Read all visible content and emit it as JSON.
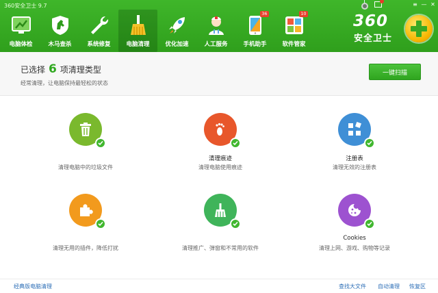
{
  "app": {
    "title": "360安全卫士 9.7"
  },
  "nav": [
    {
      "label": "电脑体检",
      "icon": "pc-check-icon"
    },
    {
      "label": "木马查杀",
      "icon": "horse-shield-icon"
    },
    {
      "label": "系统修复",
      "icon": "wrench-icon"
    },
    {
      "label": "电脑清理",
      "icon": "broom-icon",
      "active": true
    },
    {
      "label": "优化加速",
      "icon": "rocket-icon"
    },
    {
      "label": "人工服务",
      "icon": "doctor-icon"
    },
    {
      "label": "手机助手",
      "icon": "phone-icon",
      "badge": "36"
    },
    {
      "label": "软件管家",
      "icon": "software-box-icon",
      "badge": "10"
    }
  ],
  "brand": {
    "number": "360",
    "name": "安全卫士"
  },
  "header": {
    "prefix": "已选择",
    "count": "6",
    "suffix": "项清理类型",
    "subtitle": "经常清理，让电脑保持最轻松的状态",
    "scan_label": "一键扫描"
  },
  "items": [
    {
      "title": "",
      "desc": "清理电脑中的垃圾文件",
      "icon": "trash-icon",
      "color": "#7ab92d"
    },
    {
      "title": "清理痕迹",
      "desc": "清理电脑使用痕迹",
      "icon": "footprint-icon",
      "color": "#e8572b"
    },
    {
      "title": "注册表",
      "desc": "清理无效的注册表",
      "icon": "registry-blocks-icon",
      "color": "#3f8fd6"
    },
    {
      "title": "",
      "desc": "清理无用的插件，降低打扰",
      "icon": "puzzle-icon",
      "color": "#f29a1d"
    },
    {
      "title": "",
      "desc": "清理推广、弹窗和不常用的软件",
      "icon": "broom-icon",
      "color": "#3fb45a"
    },
    {
      "title": "Cookies",
      "desc": "清理上网、游戏、购物等记录",
      "icon": "cookie-icon",
      "color": "#9d52d0"
    }
  ],
  "footer": {
    "classic": "经典版电脑清理",
    "find_large": "查找大文件",
    "auto_clean": "自动清理",
    "restore": "恢复区"
  },
  "colors": {
    "green": "#3aaf25",
    "accent_count": "#2fa81f",
    "link": "#2e6fb7"
  }
}
